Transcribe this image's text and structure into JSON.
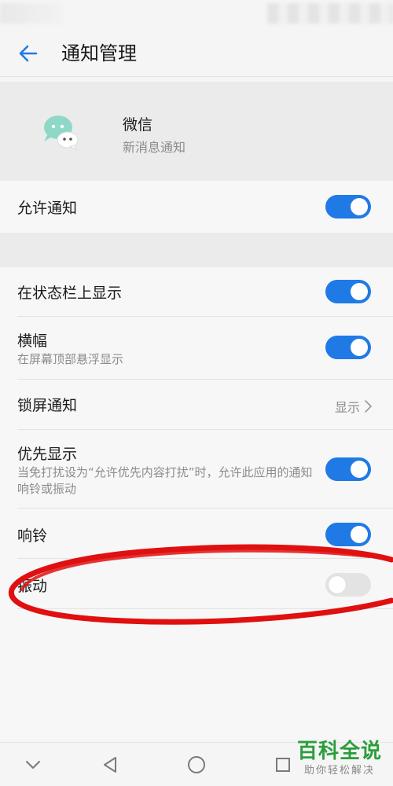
{
  "header": {
    "title": "通知管理",
    "back_icon": "arrow-left-icon"
  },
  "app": {
    "name": "微信",
    "subtitle": "新消息通知",
    "icon": "wechat-bubbles-icon"
  },
  "allow": {
    "label": "允许通知",
    "enabled": true
  },
  "settings": {
    "status_bar": {
      "label": "在状态栏上显示",
      "enabled": true
    },
    "banner": {
      "label": "横幅",
      "sub": "在屏幕顶部悬浮显示",
      "enabled": true
    },
    "lock_screen": {
      "label": "锁屏通知",
      "value": "显示"
    },
    "priority": {
      "label": "优先显示",
      "sub": "当免打扰设为“允许优先内容打扰”时，允许此应用的通知响铃或振动",
      "enabled": true
    },
    "ring": {
      "label": "响铃",
      "enabled": true
    },
    "vibrate": {
      "label": "振动",
      "enabled": false
    }
  },
  "nav": {
    "back": "triangle-back-icon",
    "home": "circle-home-icon",
    "recents": "square-recents-icon",
    "collapse": "chevron-down-icon"
  },
  "watermark": {
    "title": "百科全说",
    "subtitle": "助你轻松解决"
  },
  "colors": {
    "accent": "#1f7ae6",
    "annotation": "#e01010",
    "watermark": "#2a9e3a"
  }
}
